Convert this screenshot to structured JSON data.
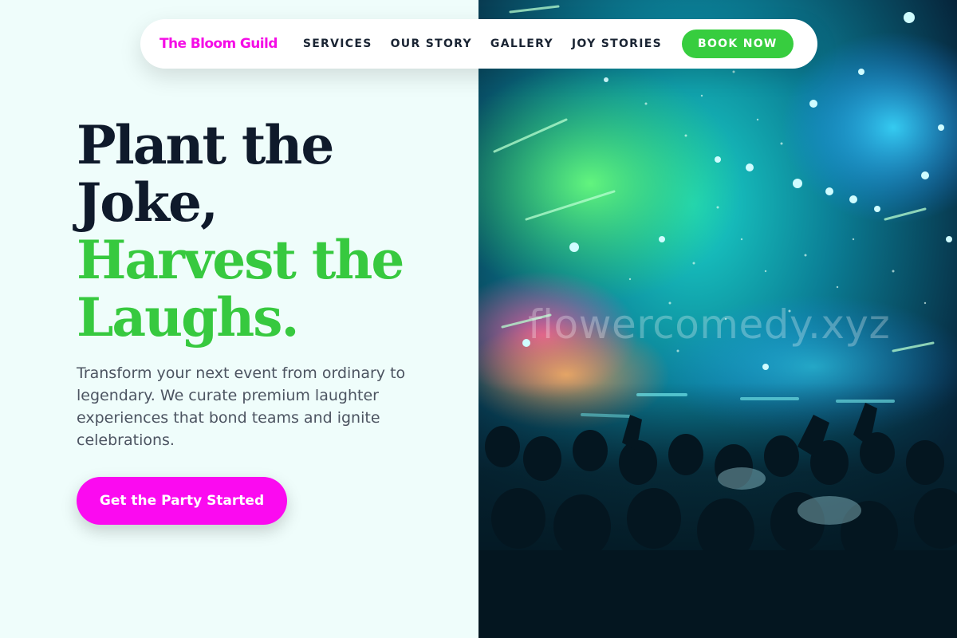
{
  "brand": {
    "name": "The Bloom Guild"
  },
  "nav": {
    "links": [
      "SERVICES",
      "OUR STORY",
      "GALLERY",
      "JOY STORIES"
    ],
    "cta_label": "BOOK NOW"
  },
  "hero": {
    "headline_line1": "Plant the",
    "headline_line2": "Joke,",
    "headline_line3": "Harvest the",
    "headline_line4": "Laughs.",
    "subtext": "Transform your next event from ordinary to legendary. We curate premium laughter experiences that bond teams and ignite celebrations.",
    "cta_label": "Get the Party Started",
    "image_watermark": "flowercomedy.xyz"
  },
  "colors": {
    "brand_pink": "#f50de6",
    "accent_green": "#37cd3f",
    "heading_dark": "#0f1a2b",
    "page_bg": "#effdfb"
  }
}
